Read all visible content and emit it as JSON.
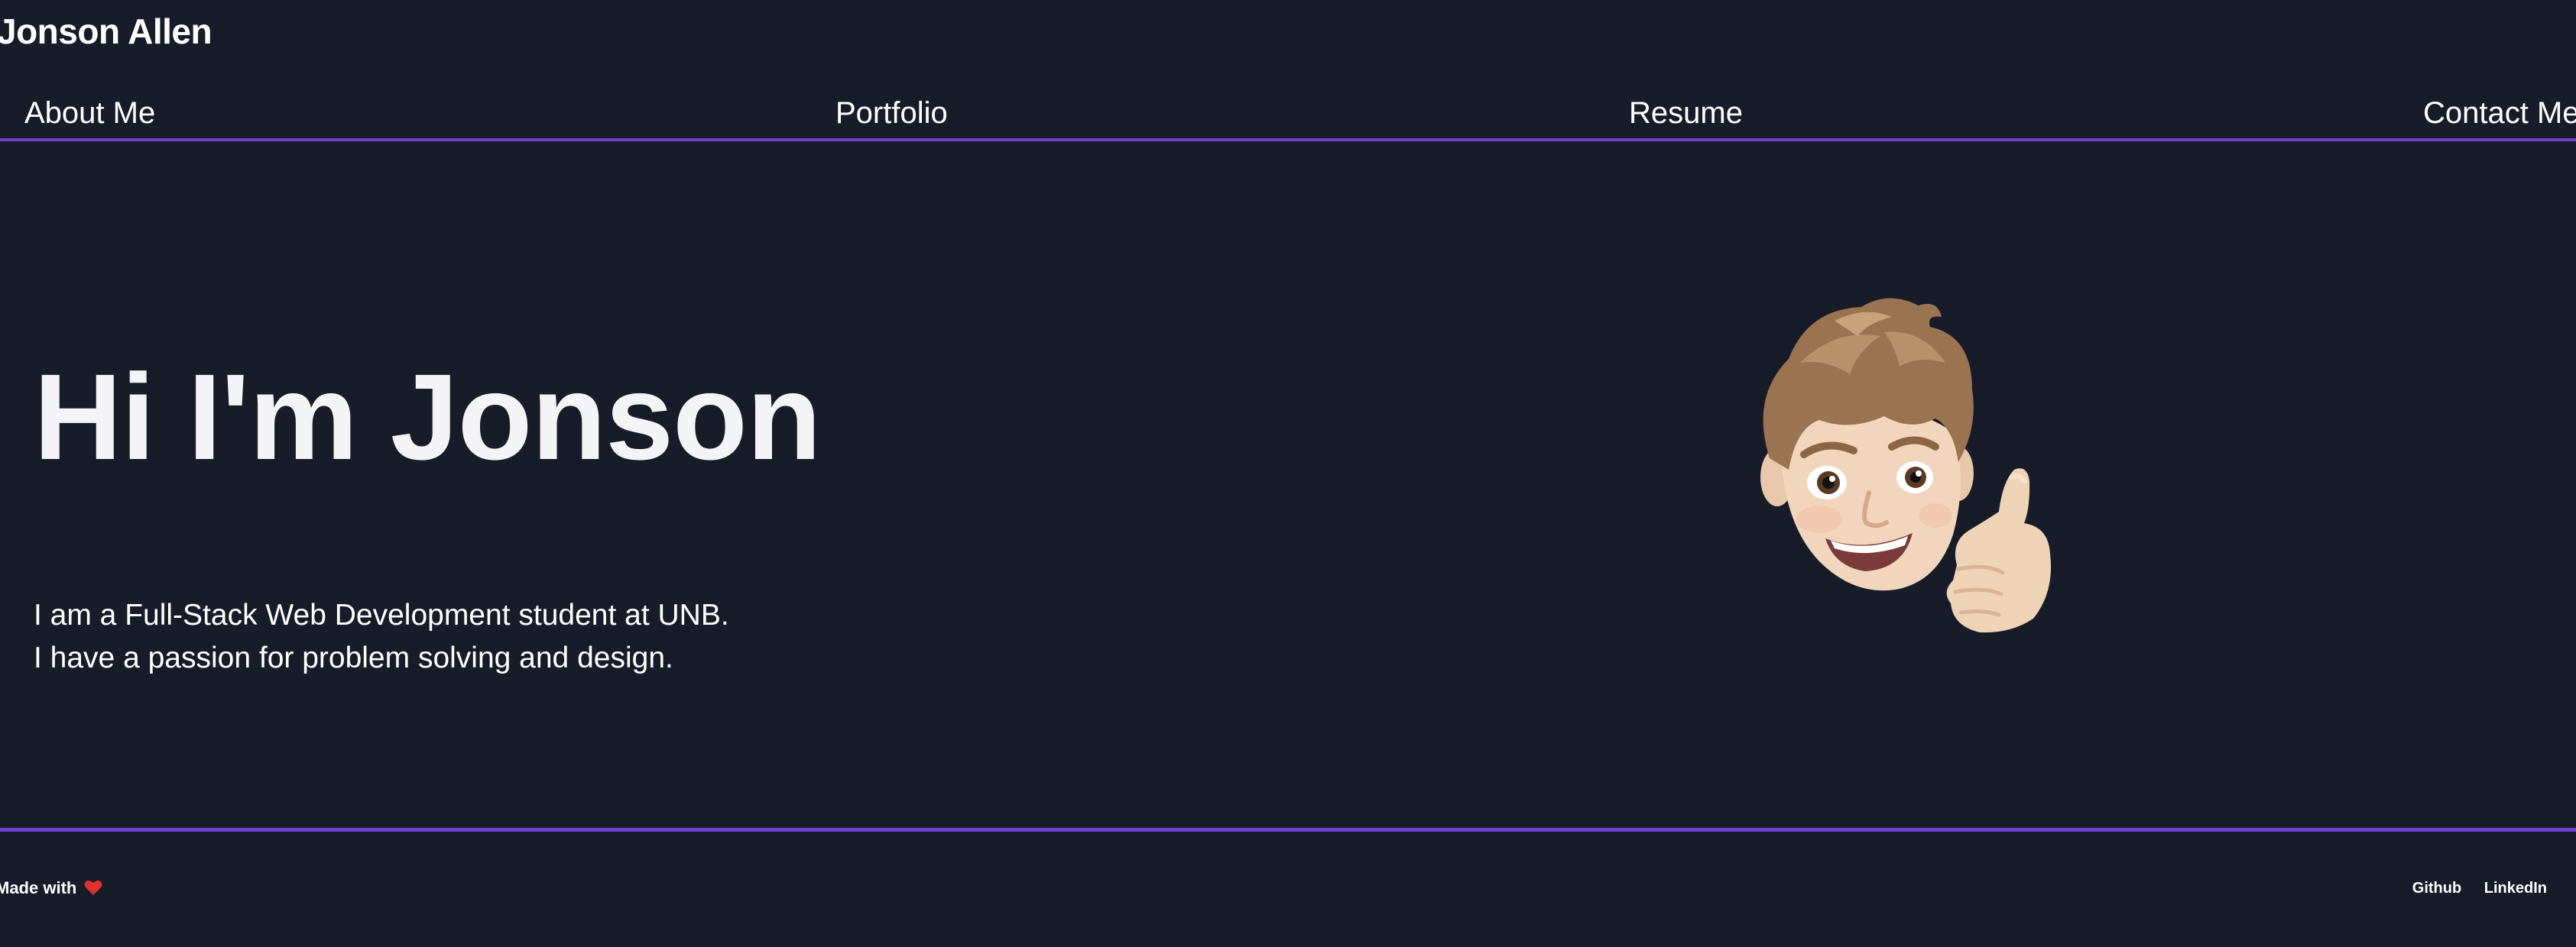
{
  "header": {
    "site_title": "Jonson Allen"
  },
  "nav": {
    "items": [
      {
        "label": "About Me"
      },
      {
        "label": "Portfolio"
      },
      {
        "label": "Resume"
      },
      {
        "label": "Contact Me"
      }
    ]
  },
  "hero": {
    "heading": "Hi I'm Jonson",
    "lines": [
      "I am a Full-Stack Web Development student at UNB.",
      "I have a passion for problem solving and design."
    ],
    "avatar_icon": "memoji-thumbs-up-icon"
  },
  "footer": {
    "made_with": "Made with",
    "heart_icon": "heart-icon",
    "links": [
      {
        "label": "Github"
      },
      {
        "label": "LinkedIn"
      }
    ]
  },
  "colors": {
    "background": "#181c28",
    "accent": "#6f3fd0",
    "text": "#ffffff",
    "heart": "#e0302f"
  }
}
